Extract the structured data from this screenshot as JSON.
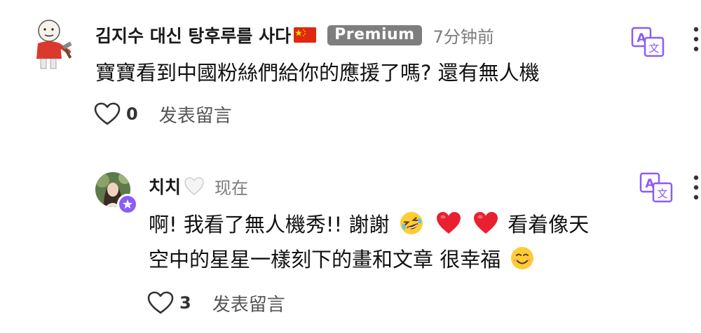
{
  "comments": [
    {
      "username": "김지수 대신 탕후루를 사다",
      "badge": "Premium",
      "time": "7分钟前",
      "text": "寶寶看到中國粉絲們給你的應援了嗎?  還有無人機",
      "like_count": "0",
      "reply_label": "发表留言",
      "icons": {
        "translate": "translate-icon",
        "more": "more-vertical-icon",
        "like": "heart-outline-icon",
        "flag": "china-flag-icon"
      }
    },
    {
      "username": "치치",
      "time": "现在",
      "text_line1_a": "啊! 我看了無人機秀!! 謝謝",
      "text_line1_b": "看着像天",
      "text_line2": "空中的星星一樣刻下的畫和文章 很幸福",
      "like_count": "3",
      "reply_label": "发表留言",
      "icons": {
        "translate": "translate-icon",
        "more": "more-vertical-icon",
        "like": "heart-outline-icon",
        "badge": "creator-star-badge-icon",
        "name_heart": "white-heart-icon"
      }
    }
  ],
  "colors": {
    "accent": "#8b5cf6",
    "badge_bg": "#7e7e7e",
    "muted_text": "#7b7b7b"
  }
}
